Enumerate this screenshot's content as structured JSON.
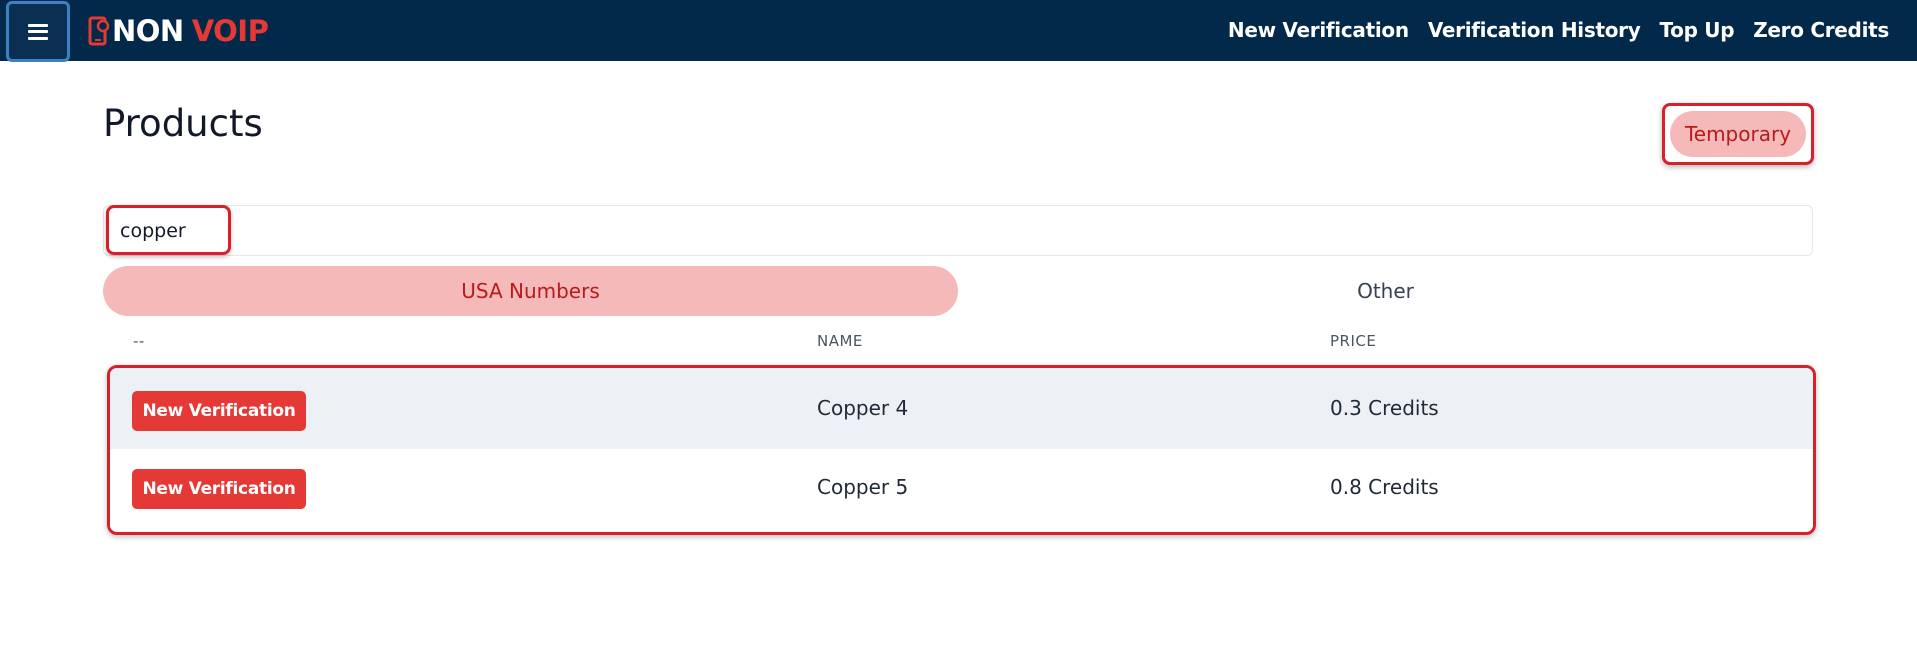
{
  "brand": {
    "part1": "NON",
    "part2": "VOIP"
  },
  "nav": {
    "links": [
      {
        "label": "New Verification"
      },
      {
        "label": "Verification History"
      },
      {
        "label": "Top Up"
      },
      {
        "label": "Zero Credits"
      }
    ]
  },
  "page": {
    "title": "Products",
    "mode_button": "Temporary"
  },
  "search": {
    "value": "copper"
  },
  "tabs": [
    {
      "label": "USA Numbers",
      "active": true
    },
    {
      "label": "Other",
      "active": false
    }
  ],
  "table": {
    "headers": [
      "--",
      "NAME",
      "PRICE"
    ],
    "rows": [
      {
        "action": "New Verification",
        "name": "Copper 4",
        "price": "0.3 Credits"
      },
      {
        "action": "New Verification",
        "name": "Copper 5",
        "price": "0.8 Credits"
      }
    ]
  },
  "colors": {
    "navbar": "#03294a",
    "accent": "#e53935",
    "tab_active_bg": "#f6b9b9",
    "highlight": "#d81f2a"
  }
}
